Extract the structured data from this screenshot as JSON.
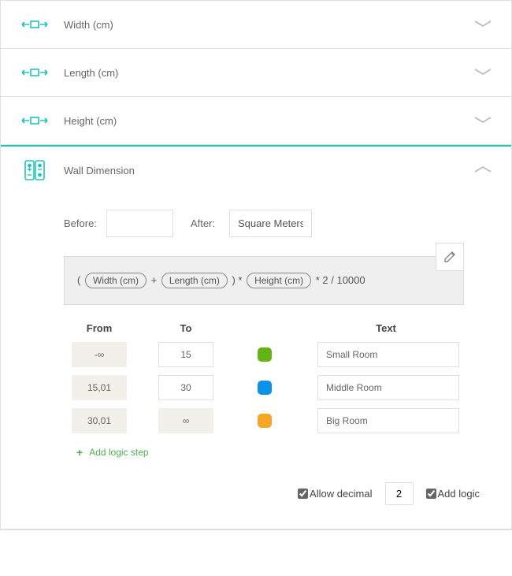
{
  "panels": [
    {
      "title": "Width (cm)"
    },
    {
      "title": "Length (cm)"
    },
    {
      "title": "Height (cm)"
    }
  ],
  "expanded": {
    "title": "Wall Dimension",
    "before_label": "Before:",
    "before_value": "",
    "after_label": "After:",
    "after_value": "Square Meters",
    "formula": {
      "open": "(",
      "t1": "Width (cm)",
      "plus": "+",
      "t2": "Length (cm)",
      "close_mul": ") *",
      "t3": "Height (cm)",
      "tail": "* 2 / 10000"
    },
    "headers": {
      "from": "From",
      "to": "To",
      "text": "Text"
    },
    "rows": [
      {
        "from": "-∞",
        "to": "15",
        "color": "#62b314",
        "text": "Small Room",
        "from_ro": true,
        "to_ro": false
      },
      {
        "from": "15,01",
        "to": "30",
        "color": "#0a91e9",
        "text": "Middle Room",
        "from_ro": true,
        "to_ro": false
      },
      {
        "from": "30,01",
        "to": "∞",
        "color": "#f5a623",
        "text": "Big Room",
        "from_ro": true,
        "to_ro": true
      }
    ],
    "add_step": "Add logic step",
    "allow_decimal_label": "Allow decimal",
    "decimal_value": "2",
    "add_logic_label": "Add logic"
  }
}
